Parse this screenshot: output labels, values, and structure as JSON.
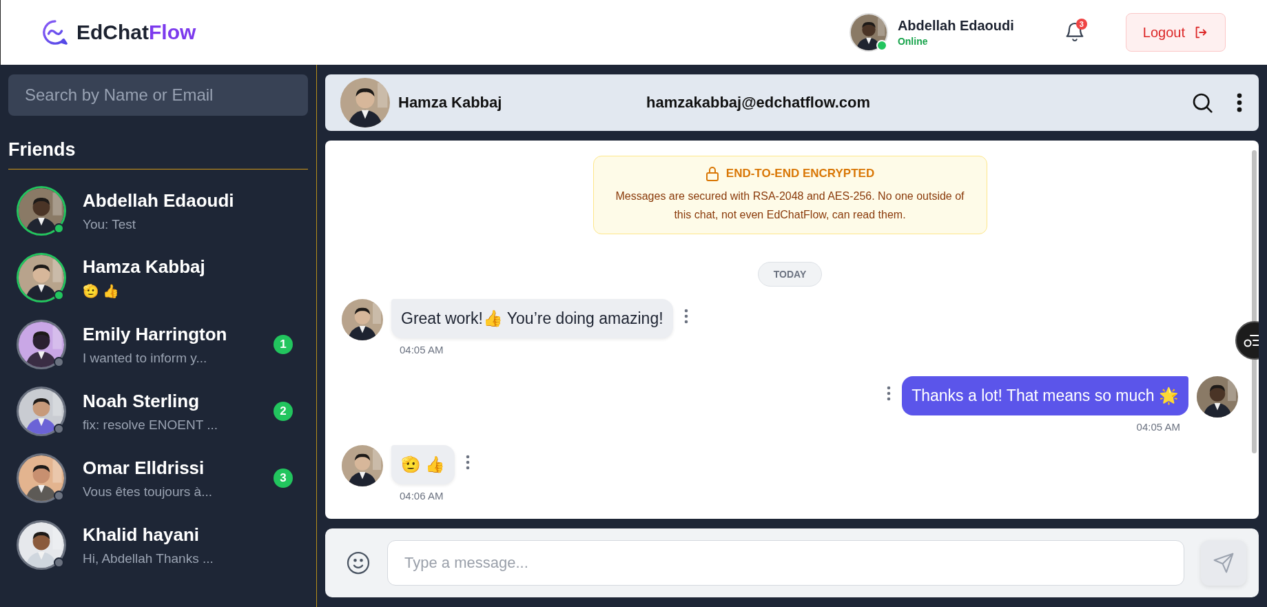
{
  "header": {
    "logo": {
      "main": "EdChat",
      "accent": "Flow"
    },
    "user": {
      "name": "Abdellah Edaoudi",
      "status": "Online",
      "online": true
    },
    "notifications": {
      "count": "3"
    },
    "logout": "Logout"
  },
  "sidebar": {
    "search": {
      "placeholder": "Search by Name or Email"
    },
    "title": "Friends",
    "friends": [
      {
        "name": "Abdellah Edaoudi",
        "preview": "You: Test",
        "online": true
      },
      {
        "name": "Hamza Kabbaj",
        "preview": "🫡 👍",
        "online": true
      },
      {
        "name": "Emily Harrington",
        "preview": "I wanted to inform y...",
        "online": false,
        "unread": "1"
      },
      {
        "name": "Noah Sterling",
        "preview": "fix: resolve ENOENT ...",
        "online": false,
        "unread": "2"
      },
      {
        "name": "Omar Elldrissi",
        "preview": "Vous êtes toujours à...",
        "online": false,
        "unread": "3"
      },
      {
        "name": "Khalid hayani",
        "preview": "Hi, Abdellah Thanks ...",
        "online": false
      }
    ]
  },
  "chat": {
    "contact": {
      "name": "Hamza Kabbaj",
      "email": "hamzakabbaj@edchatflow.com"
    },
    "banner": {
      "title": "END-TO-END ENCRYPTED",
      "text": "Messages are secured with RSA-2048 and AES-256. No one outside of this chat, not even EdChatFlow, can read them."
    },
    "date": "TODAY",
    "messages": [
      {
        "kind": "incoming",
        "text": "Great work!👍  You’re doing amazing!",
        "time": "04:05 AM"
      },
      {
        "kind": "outgoing",
        "text": "Thanks a lot! That means so much 🌟",
        "time": "04:05 AM"
      },
      {
        "kind": "incoming",
        "text": "🫡 👍",
        "time": "04:06 AM"
      }
    ],
    "composer": {
      "placeholder": "Type a message..."
    }
  }
}
